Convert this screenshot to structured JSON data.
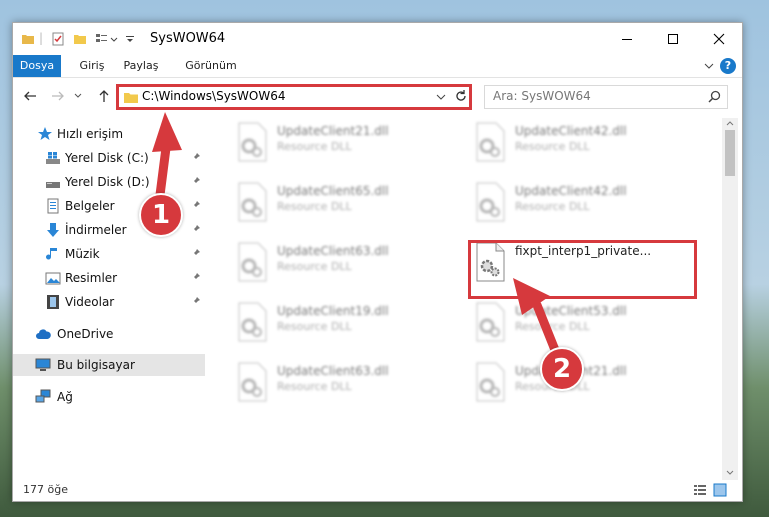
{
  "window": {
    "title": "SysWOW64"
  },
  "ribbon": {
    "tabs": [
      "Dosya",
      "Giriş",
      "Paylaş",
      "Görünüm"
    ],
    "help": "?"
  },
  "address": {
    "path": "C:\\Windows\\SysWOW64",
    "search_placeholder": "Ara: SysWOW64"
  },
  "sidebar": {
    "items": [
      {
        "label": "Hızlı erişim"
      },
      {
        "label": "Yerel Disk (C:)"
      },
      {
        "label": "Yerel Disk (D:)"
      },
      {
        "label": "Belgeler"
      },
      {
        "label": "İndirmeler"
      },
      {
        "label": "Müzik"
      },
      {
        "label": "Resimler"
      },
      {
        "label": "Videolar"
      },
      {
        "label": "OneDrive"
      },
      {
        "label": "Bu bilgisayar"
      },
      {
        "label": "Ağ"
      }
    ]
  },
  "files": [
    {
      "name": "UpdateClient21.dll",
      "type": "Resource DLL"
    },
    {
      "name": "UpdateClient42.dll",
      "type": "Resource DLL"
    },
    {
      "name": "UpdateClient65.dll",
      "type": "Resource DLL"
    },
    {
      "name": "UpdateClient42.dll",
      "type": "Resource DLL"
    },
    {
      "name": "UpdateClient63.dll",
      "type": "Resource DLL"
    },
    {
      "name": "fixpt_interp1_private...",
      "type": ""
    },
    {
      "name": "UpdateClient19.dll",
      "type": "Resource DLL"
    },
    {
      "name": "UpdateClient53.dll",
      "type": "Resource DLL"
    },
    {
      "name": "UpdateClient63.dll",
      "type": "Resource DLL"
    },
    {
      "name": "UpdateClient21.dll",
      "type": "Resource DLL"
    }
  ],
  "status": {
    "count": "177 öğe"
  },
  "callouts": {
    "one": "1",
    "two": "2"
  },
  "colors": {
    "accent": "#1979ca",
    "highlight": "#d6393d"
  }
}
